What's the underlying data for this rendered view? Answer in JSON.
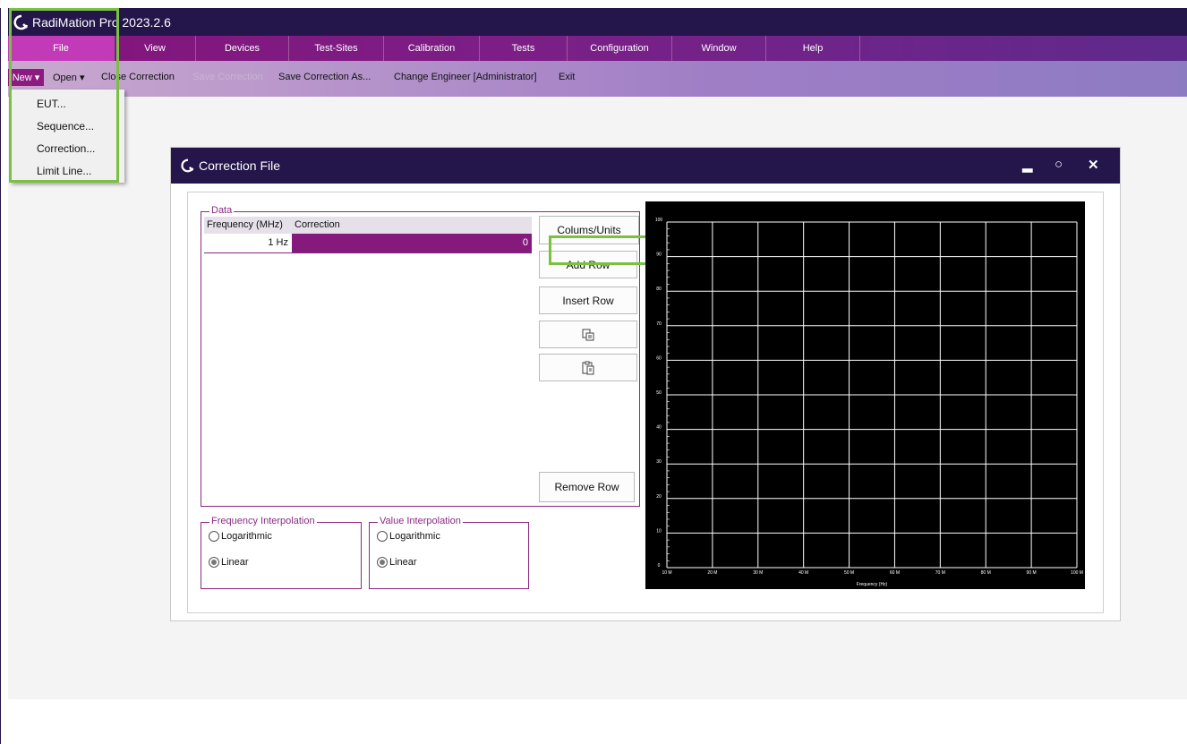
{
  "app": {
    "title": "RadiMation Pro 2023.2.6"
  },
  "menu": [
    "File",
    "View",
    "Devices",
    "Test-Sites",
    "Calibration",
    "Tests",
    "Configuration",
    "Window",
    "Help"
  ],
  "ribbon": {
    "new": "New ▾",
    "open": "Open ▾",
    "close_correction": "Close Correction",
    "save_correction": "Save Correction",
    "save_correction_as": "Save Correction As...",
    "change_engineer": "Change Engineer [Administrator]",
    "exit": "Exit"
  },
  "new_menu": [
    "EUT...",
    "Sequence...",
    "Correction...",
    "Limit Line..."
  ],
  "dialog": {
    "title": "Correction File",
    "data_group": "Data",
    "columns": [
      "Frequency (MHz)",
      "Correction"
    ],
    "rows": [
      {
        "frequency": "1 Hz",
        "correction": "0"
      }
    ],
    "buttons": {
      "columns_units": "Colums/Units",
      "add_row": "Add Row",
      "insert_row": "Insert Row",
      "remove_row": "Remove Row"
    },
    "freq_interp": {
      "label": "Frequency Interpolation",
      "options": [
        "Logarithmic",
        "Linear"
      ],
      "selected": "Linear"
    },
    "value_interp": {
      "label": "Value Interpolation",
      "options": [
        "Logarithmic",
        "Linear"
      ],
      "selected": "Linear"
    }
  },
  "chart_data": {
    "type": "line",
    "title": "",
    "xlabel": "Frequency (Hz)",
    "ylabel": "",
    "xlim": [
      10,
      100
    ],
    "ylim": [
      0,
      100
    ],
    "xticks": [
      "10 M",
      "20 M",
      "30 M",
      "40 M",
      "50 M",
      "60 M",
      "70 M",
      "80 M",
      "90 M",
      "100 M"
    ],
    "yticks": [
      "0",
      "10",
      "20",
      "30",
      "40",
      "50",
      "60",
      "70",
      "80",
      "90",
      "100"
    ],
    "series": [],
    "grid": true,
    "background": "#000000"
  },
  "colors": {
    "title_bar": "#24164a",
    "menu_purple": "#84147a",
    "selected_cell": "#861a7c",
    "highlight_box": "#7ac142"
  }
}
